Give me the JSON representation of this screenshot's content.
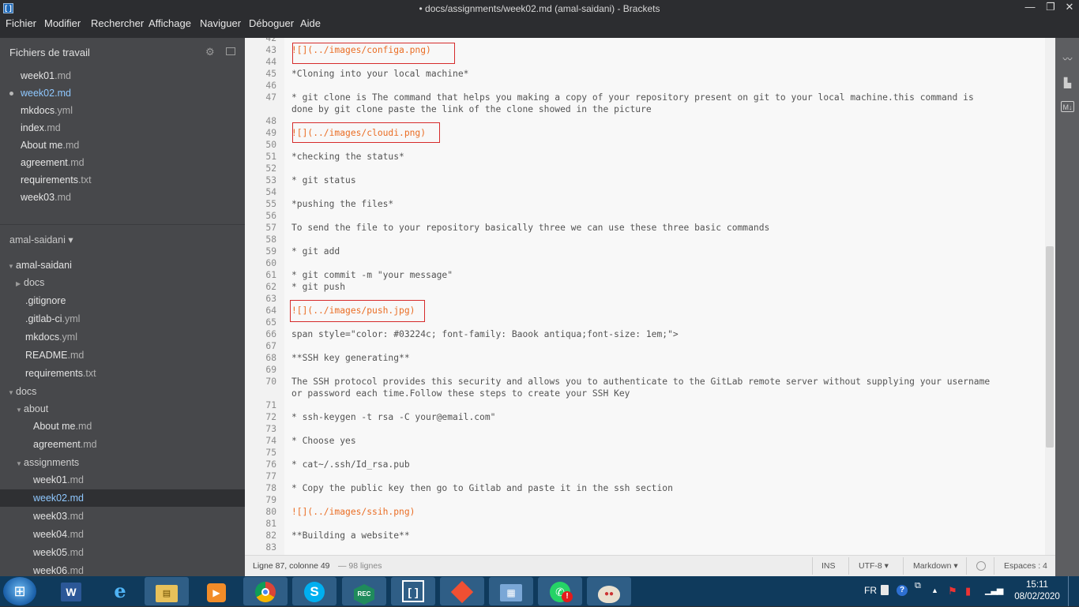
{
  "window": {
    "title": "• docs/assignments/week02.md (amal-saidani) - Brackets",
    "minimize": "—",
    "maximize": "❐",
    "close": "✕"
  },
  "menu": [
    "Fichier",
    "Modifier",
    "Rechercher",
    "Affichage",
    "Naviguer",
    "Déboguer",
    "Aide"
  ],
  "sidebar": {
    "working_files_title": "Fichiers de travail",
    "working_files": [
      {
        "name": "week01",
        "ext": ".md"
      },
      {
        "name": "week02",
        "ext": ".md"
      },
      {
        "name": "mkdocs",
        "ext": ".yml"
      },
      {
        "name": "index",
        "ext": ".md"
      },
      {
        "name": "About me",
        "ext": ".md"
      },
      {
        "name": "agreement",
        "ext": ".md"
      },
      {
        "name": "requirements",
        "ext": ".txt"
      },
      {
        "name": "week03",
        "ext": ".md"
      }
    ],
    "project_title": "amal-saidani ▾",
    "tree": [
      {
        "name": "amal-saidani",
        "ext": "",
        "folder": true
      },
      {
        "name": "docs",
        "ext": "",
        "folder": true
      },
      {
        "name": ".gitignore",
        "ext": ""
      },
      {
        "name": ".gitlab-ci",
        "ext": ".yml"
      },
      {
        "name": "mkdocs",
        "ext": ".yml"
      },
      {
        "name": "README",
        "ext": ".md"
      },
      {
        "name": "requirements",
        "ext": ".txt"
      },
      {
        "name": "docs",
        "ext": "",
        "folder": true
      },
      {
        "name": "about",
        "ext": "",
        "folder": true
      },
      {
        "name": "About me",
        "ext": ".md"
      },
      {
        "name": "agreement",
        "ext": ".md"
      },
      {
        "name": "assignments",
        "ext": "",
        "folder": true
      },
      {
        "name": "week01",
        "ext": ".md"
      },
      {
        "name": "week02",
        "ext": ".md"
      },
      {
        "name": "week03",
        "ext": ".md"
      },
      {
        "name": "week04",
        "ext": ".md"
      },
      {
        "name": "week05",
        "ext": ".md"
      },
      {
        "name": "week06",
        "ext": ".md"
      }
    ]
  },
  "editor": {
    "lines": [
      {
        "n": "42",
        "t": ""
      },
      {
        "n": "43",
        "t": "![](../images/configa.png)",
        "link": true
      },
      {
        "n": "44",
        "t": ""
      },
      {
        "n": "45",
        "t": "*Cloning into your local machine*"
      },
      {
        "n": "46",
        "t": ""
      },
      {
        "n": "47",
        "t": "* git clone is The command that helps you making a copy of your repository present on git to your local machine.this command is"
      },
      {
        "n": "",
        "t": "done by git clone paste the link of the clone showed in the picture"
      },
      {
        "n": "48",
        "t": ""
      },
      {
        "n": "49",
        "t": "![](../images/cloudi.png)",
        "link": true
      },
      {
        "n": "50",
        "t": ""
      },
      {
        "n": "51",
        "t": "*checking the status*"
      },
      {
        "n": "52",
        "t": ""
      },
      {
        "n": "53",
        "t": "* git status"
      },
      {
        "n": "54",
        "t": ""
      },
      {
        "n": "55",
        "t": "*pushing the files*"
      },
      {
        "n": "56",
        "t": ""
      },
      {
        "n": "57",
        "t": "To send the file to your repository basically three we can use these three basic commands"
      },
      {
        "n": "58",
        "t": ""
      },
      {
        "n": "59",
        "t": "* git add"
      },
      {
        "n": "60",
        "t": ""
      },
      {
        "n": "61",
        "t": "* git commit -m \"your message\""
      },
      {
        "n": "62",
        "t": "* git push"
      },
      {
        "n": "63",
        "t": ""
      },
      {
        "n": "64",
        "t": "![](../images/push.jpg)",
        "link": true
      },
      {
        "n": "65",
        "t": ""
      },
      {
        "n": "66",
        "t": "span style=\"color: #03224c; font-family: Baook antiqua;font-size: 1em;\">"
      },
      {
        "n": "67",
        "t": ""
      },
      {
        "n": "68",
        "t": "**SSH key generating**"
      },
      {
        "n": "69",
        "t": ""
      },
      {
        "n": "70",
        "t": "The SSH protocol provides this security and allows you to authenticate to the GitLab remote server without supplying your username"
      },
      {
        "n": "",
        "t": "or password each time.Follow these steps to create your SSH Key"
      },
      {
        "n": "71",
        "t": ""
      },
      {
        "n": "72",
        "t": "* ssh-keygen -t rsa -C your@email.com\""
      },
      {
        "n": "73",
        "t": ""
      },
      {
        "n": "74",
        "t": "* Choose yes"
      },
      {
        "n": "75",
        "t": ""
      },
      {
        "n": "76",
        "t": "* cat~/.ssh/Id_rsa.pub"
      },
      {
        "n": "77",
        "t": ""
      },
      {
        "n": "78",
        "t": "* Copy the public key then go to Gitlab and paste it in the ssh section"
      },
      {
        "n": "79",
        "t": ""
      },
      {
        "n": "80",
        "t": "![](../images/ssih.png)",
        "link": true
      },
      {
        "n": "81",
        "t": ""
      },
      {
        "n": "82",
        "t": "**Building a website**"
      },
      {
        "n": "83",
        "t": ""
      }
    ]
  },
  "status": {
    "position": "Ligne 87, colonne 49",
    "lines_count": "— 98 lignes",
    "mode": "INS",
    "encoding": "UTF-8 ▾",
    "language": "Markdown ▾",
    "spaces": "Espaces : 4"
  },
  "taskbar": {
    "apps": [
      "word",
      "internet-explorer",
      "file-explorer",
      "media-player",
      "chrome",
      "skype",
      "recorder",
      "brackets",
      "git",
      "control-panel",
      "whatsapp",
      "paint"
    ],
    "lang": "FR",
    "time": "15:11",
    "date": "08/02/2020"
  },
  "colors": {
    "accent": "#8fc8ff",
    "link": "#ea6d24",
    "highlight_box": "#d62b2b",
    "taskbar": "#0f3a5c"
  }
}
